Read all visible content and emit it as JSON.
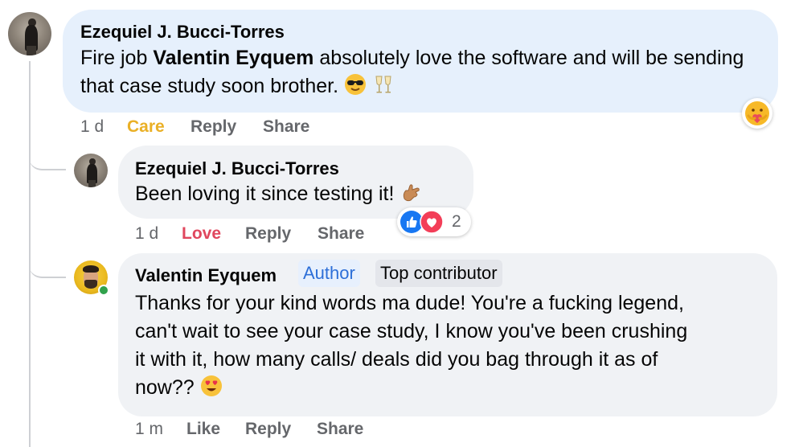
{
  "comments": [
    {
      "author": "Ezequiel J. Bucci-Torres",
      "text_prefix": "Fire job ",
      "mention": "Valentin Eyquem",
      "text_suffix": " absolutely love the software and will be sending that case study soon brother.",
      "emojis": [
        "sunglasses-face-emoji",
        "clinking-glasses-emoji"
      ],
      "time": "1 d",
      "reaction_label": "Care",
      "reply_label": "Reply",
      "share_label": "Share",
      "reaction_badge": "care-reaction-icon"
    },
    {
      "author": "Ezequiel J. Bucci-Torres",
      "text": "Been loving it since testing it!",
      "emojis": [
        "call-me-hand-emoji"
      ],
      "time": "1 d",
      "reaction_label": "Love",
      "reply_label": "Reply",
      "share_label": "Share",
      "reaction_icons": [
        "like-reaction-icon",
        "love-reaction-icon"
      ],
      "reaction_count": "2"
    },
    {
      "author": "Valentin Eyquem",
      "badges": [
        "Author",
        "Top contributor"
      ],
      "lines": [
        "Thanks for your kind words ma dude! You're a fucking legend,",
        "can't wait to see your case study, I know you've been crushing",
        "it with it, how many calls/ deals did you bag through it as of",
        "now??"
      ],
      "emojis": [
        "heart-eyes-emoji"
      ],
      "time": "1 m",
      "reaction_label": "Like",
      "reply_label": "Reply",
      "share_label": "Share"
    }
  ],
  "colors": {
    "bubble_highlight": "#e6f0fc",
    "bubble": "#f0f2f5",
    "care": "#eab026",
    "love": "#e0475e",
    "meta": "#65676b",
    "author_badge": "#2d6fd8",
    "online": "#31a24c"
  }
}
